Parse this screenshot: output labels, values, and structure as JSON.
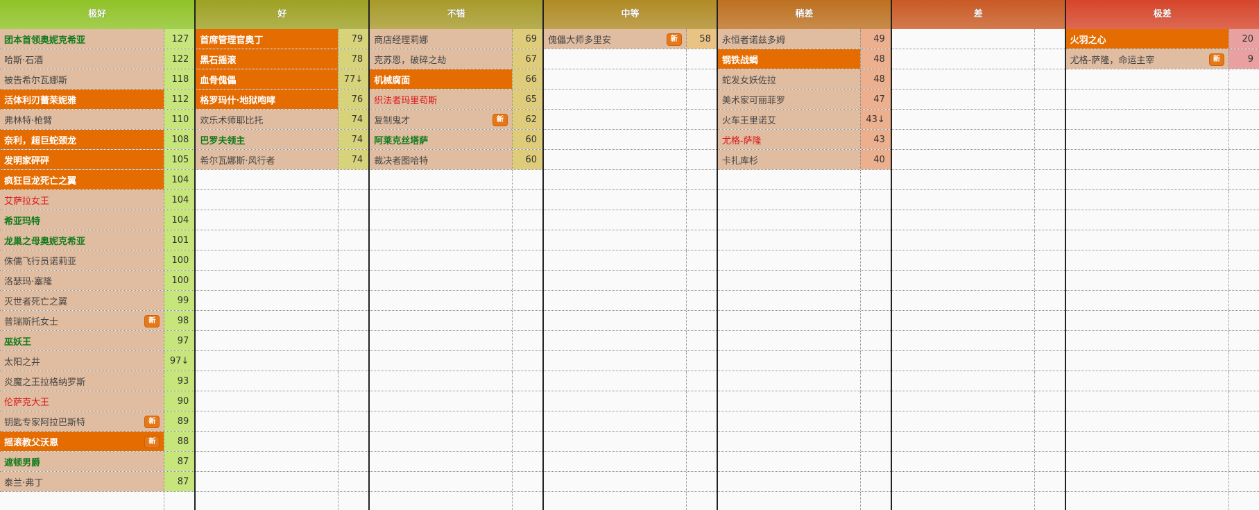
{
  "tier_colors": {
    "极好": "#8fc326",
    "好": "#9ea123",
    "不错": "#a79a2a",
    "中等": "#b08b25",
    "稍差": "#bd7020",
    "差": "#c95a24",
    "极差": "#d6452a"
  },
  "score_colors": {
    "极好": "#c6e57a",
    "好": "#d6d37a",
    "不错": "#dfcc7a",
    "中等": "#e8c384",
    "稍差": "#ecb08f",
    "差": "#fafafa",
    "极差": "#e8a0a0"
  },
  "columns": [
    {
      "key": "ji_hao",
      "title": "极好",
      "wide": true,
      "rows": [
        {
          "name": "团本首领奥妮克希亚",
          "score": "127",
          "bg": "beige",
          "style": "green"
        },
        {
          "name": "哈斯·石酒",
          "score": "122",
          "bg": "beige",
          "style": ""
        },
        {
          "name": "被告希尔瓦娜斯",
          "score": "118",
          "bg": "beige",
          "style": ""
        },
        {
          "name": "活体利刃蕾茉妮雅",
          "score": "112",
          "bg": "orange",
          "style": ""
        },
        {
          "name": "弗林特·枪臂",
          "score": "110",
          "bg": "beige",
          "style": ""
        },
        {
          "name": "奈利，超巨蛇颈龙",
          "score": "108",
          "bg": "orange",
          "style": ""
        },
        {
          "name": "发明家砰砰",
          "score": "105",
          "bg": "orange",
          "style": ""
        },
        {
          "name": "疯狂巨龙死亡之翼",
          "score": "104",
          "bg": "orange",
          "style": ""
        },
        {
          "name": "艾萨拉女王",
          "score": "104",
          "bg": "beige",
          "style": "red"
        },
        {
          "name": "希亚玛特",
          "score": "104",
          "bg": "beige",
          "style": "green"
        },
        {
          "name": "龙巢之母奥妮克希亚",
          "score": "101",
          "bg": "beige",
          "style": "green"
        },
        {
          "name": "侏儒飞行员诺莉亚",
          "score": "100",
          "bg": "beige",
          "style": ""
        },
        {
          "name": "洛瑟玛·塞隆",
          "score": "100",
          "bg": "beige",
          "style": ""
        },
        {
          "name": "灭世者死亡之翼",
          "score": "99",
          "bg": "beige",
          "style": ""
        },
        {
          "name": "普瑞斯托女士",
          "score": "98",
          "bg": "beige",
          "style": "",
          "badge": "新"
        },
        {
          "name": "巫妖王",
          "score": "97",
          "bg": "beige",
          "style": "green"
        },
        {
          "name": "太阳之井",
          "score": "97↓",
          "bg": "beige",
          "style": ""
        },
        {
          "name": "炎魔之王拉格纳罗斯",
          "score": "93",
          "bg": "beige",
          "style": ""
        },
        {
          "name": "伦萨克大王",
          "score": "90",
          "bg": "beige",
          "style": "red"
        },
        {
          "name": "钥匙专家阿拉巴斯特",
          "score": "89",
          "bg": "beige",
          "style": "",
          "badge": "新"
        },
        {
          "name": "摇滚教父沃恩",
          "score": "88",
          "bg": "orange",
          "style": "",
          "badge": "新"
        },
        {
          "name": "遮顿男爵",
          "score": "87",
          "bg": "beige",
          "style": "green"
        },
        {
          "name": "泰兰·弗丁",
          "score": "87",
          "bg": "beige",
          "style": ""
        }
      ]
    },
    {
      "key": "hao",
      "title": "好",
      "wide": false,
      "rows": [
        {
          "name": "首席管理官奥丁",
          "score": "79",
          "bg": "orange",
          "style": ""
        },
        {
          "name": "黑石摇滚",
          "score": "78",
          "bg": "orange",
          "style": ""
        },
        {
          "name": "血骨傀儡",
          "score": "77↓",
          "bg": "orange",
          "style": ""
        },
        {
          "name": "格罗玛什·地狱咆哮",
          "score": "76",
          "bg": "orange",
          "style": ""
        },
        {
          "name": "欢乐术师耶比托",
          "score": "74",
          "bg": "beige",
          "style": ""
        },
        {
          "name": "巴罗夫领主",
          "score": "74",
          "bg": "beige",
          "style": "green"
        },
        {
          "name": "希尔瓦娜斯·风行者",
          "score": "74",
          "bg": "beige",
          "style": ""
        }
      ]
    },
    {
      "key": "bu_cuo",
      "title": "不错",
      "wide": false,
      "rows": [
        {
          "name": "商店经理莉娜",
          "score": "69",
          "bg": "beige",
          "style": ""
        },
        {
          "name": "克苏恩，破碎之劫",
          "score": "67",
          "bg": "beige",
          "style": ""
        },
        {
          "name": "机械腐面",
          "score": "66",
          "bg": "orange",
          "style": ""
        },
        {
          "name": "织法者玛里苟斯",
          "score": "65",
          "bg": "beige",
          "style": "red"
        },
        {
          "name": "复制鬼才",
          "score": "62",
          "bg": "beige",
          "style": "",
          "badge": "新"
        },
        {
          "name": "阿莱克丝塔萨",
          "score": "60",
          "bg": "beige",
          "style": "green"
        },
        {
          "name": "裁决者图哈特",
          "score": "60",
          "bg": "beige",
          "style": ""
        }
      ]
    },
    {
      "key": "zhong_deng",
      "title": "中等",
      "wide": false,
      "rows": [
        {
          "name": "傀儡大师多里安",
          "score": "58",
          "bg": "beige",
          "style": "",
          "badge": "新"
        }
      ]
    },
    {
      "key": "shao_cha",
      "title": "稍差",
      "wide": false,
      "rows": [
        {
          "name": "永恒者诺兹多姆",
          "score": "49",
          "bg": "beige",
          "style": ""
        },
        {
          "name": "钢铁战蝎",
          "score": "48",
          "bg": "orange",
          "style": ""
        },
        {
          "name": "蛇发女妖佐拉",
          "score": "48",
          "bg": "beige",
          "style": ""
        },
        {
          "name": "美术家可丽菲罗",
          "score": "47",
          "bg": "beige",
          "style": ""
        },
        {
          "name": "火车王里诺艾",
          "score": "43↓",
          "bg": "beige",
          "style": ""
        },
        {
          "name": "尤格-萨隆",
          "score": "43",
          "bg": "beige",
          "style": "red"
        },
        {
          "name": "卡扎库杉",
          "score": "40",
          "bg": "beige",
          "style": ""
        }
      ]
    },
    {
      "key": "cha",
      "title": "差",
      "wide": false,
      "rows": []
    },
    {
      "key": "ji_cha",
      "title": "极差",
      "wide": true,
      "rows": [
        {
          "name": "火羽之心",
          "score": "20",
          "bg": "orange",
          "style": ""
        },
        {
          "name": "尤格-萨隆，命运主宰",
          "score": "9",
          "bg": "beige",
          "style": "",
          "badge": "新"
        }
      ]
    }
  ]
}
